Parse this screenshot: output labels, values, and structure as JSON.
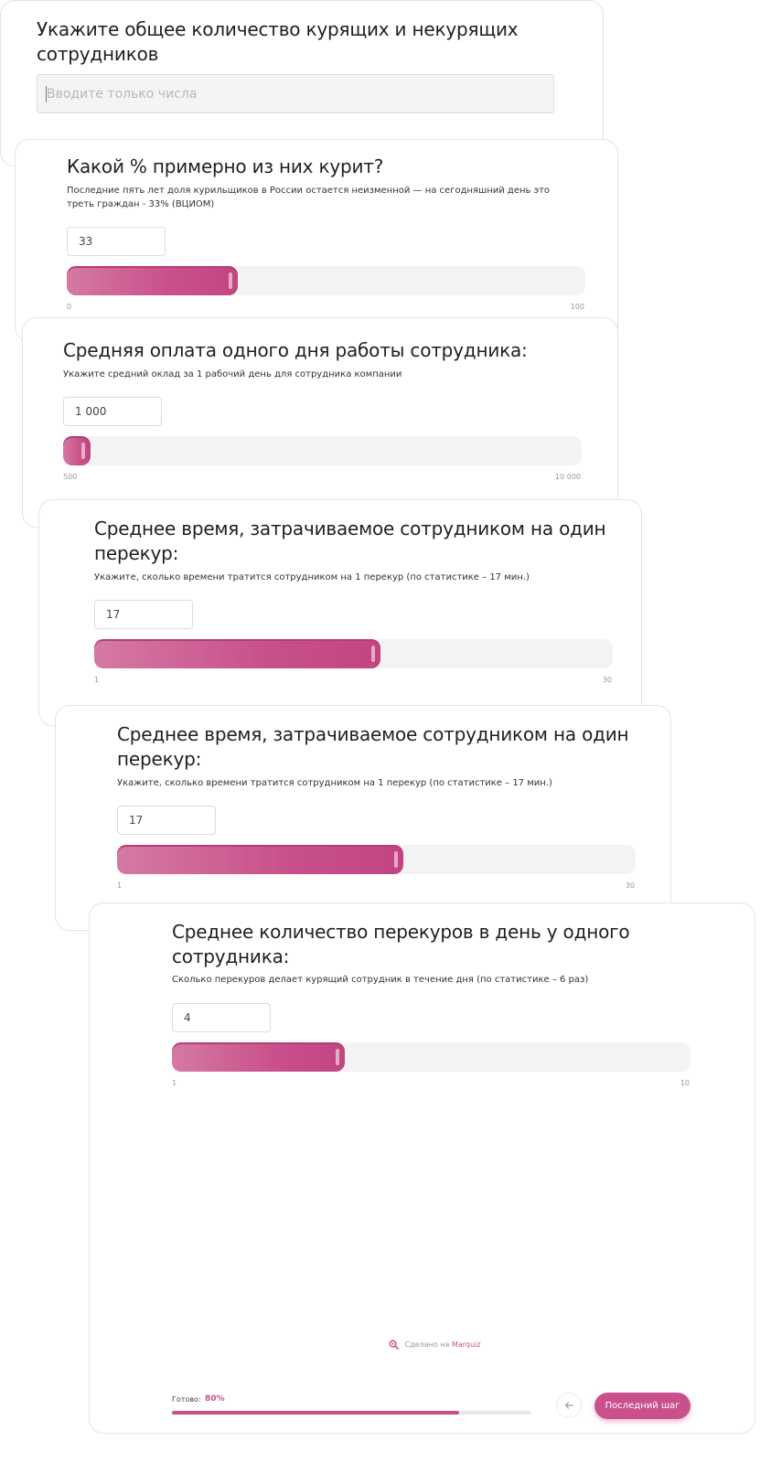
{
  "card1": {
    "title": "Укажите общее количество курящих и некурящих сотрудников",
    "placeholder": "Вводите только числа"
  },
  "card2": {
    "title": "Какой % примерно из них курит?",
    "subtitle": "Последние пять лет доля курильщиков в России остается неизменной — на сегодняшний день это треть граждан - 33% (ВЦИОМ)",
    "value": "33",
    "min": "0",
    "max": "100",
    "fraction": 0.33
  },
  "card3": {
    "title": "Средняя оплата одного дня работы сотрудника:",
    "subtitle": "Укажите средний оклад за 1 рабочий день для сотрудника компании",
    "value": "1 000",
    "min": "500",
    "max": "10 000",
    "fraction": 0.053
  },
  "card4": {
    "title": "Среднее время, затрачиваемое сотрудником на один перекур:",
    "subtitle": "Укажите, сколько времени тратится сотрудником на 1 перекур (по статистике – 17 мин.)",
    "value": "17",
    "min": "1",
    "max": "30",
    "fraction": 0.552
  },
  "card5": {
    "title": "Среднее время, затрачиваемое сотрудником на один перекур:",
    "subtitle": "Укажите, сколько времени тратится сотрудником на 1 перекур (по статистике – 17 мин.)",
    "value": "17",
    "min": "1",
    "max": "30",
    "fraction": 0.552
  },
  "card6": {
    "title": "Среднее количество перекуров в день у одного сотрудника:",
    "subtitle": "Сколько перекуров делает курящий сотрудник в течение дня (по статистике – 6 раз)",
    "value": "4",
    "min": "1",
    "max": "10",
    "fraction": 0.333
  },
  "footer": {
    "made_with_prefix": "Сделано на",
    "made_with_brand": "Marquiz",
    "progress_label": "Готово:",
    "progress_value": "80%",
    "progress_fraction": 0.8,
    "next_button": "Последний шаг"
  },
  "colors": {
    "accent": "#c9508a",
    "track": "#f3f3f3"
  }
}
